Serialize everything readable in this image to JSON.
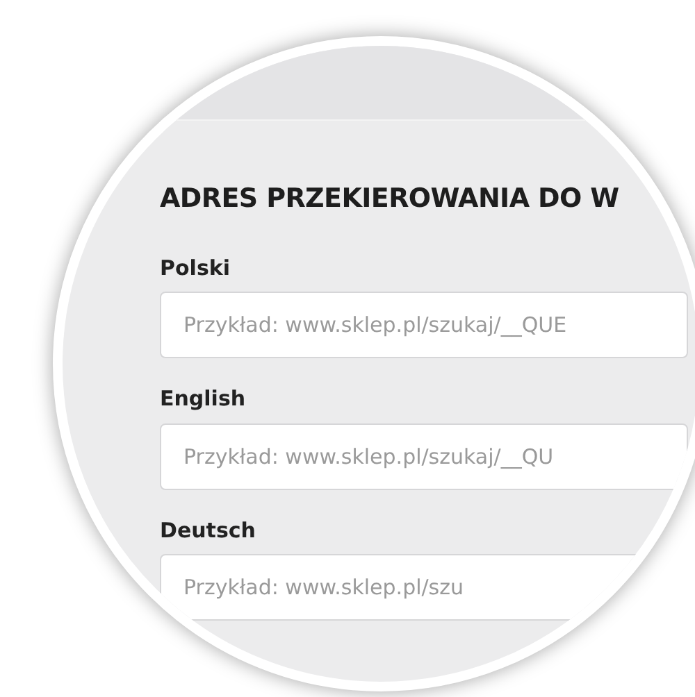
{
  "section": {
    "title": "ADRES PRZEKIEROWANIA DO W",
    "fields": [
      {
        "label": "Polski",
        "placeholder": "Przykład: www.sklep.pl/szukaj/__QUE"
      },
      {
        "label": "English",
        "placeholder": "Przykład: www.sklep.pl/szukaj/__QU"
      },
      {
        "label": "Deutsch",
        "placeholder": "Przykład: www.sklep.pl/szu"
      }
    ]
  }
}
